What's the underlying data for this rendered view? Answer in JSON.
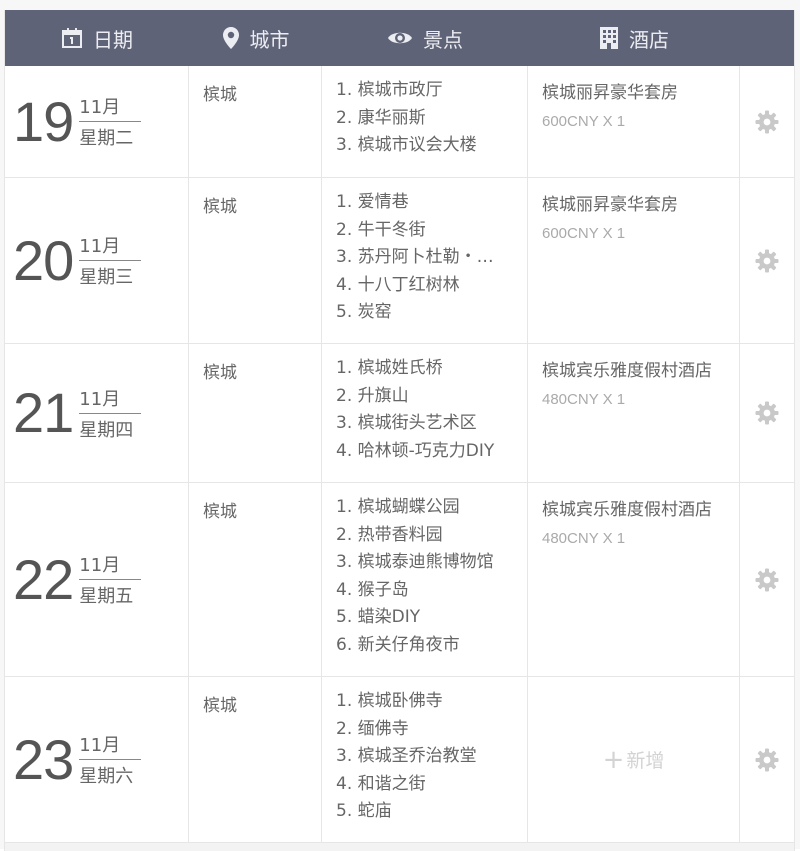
{
  "header": {
    "date_label": "日期",
    "city_label": "城市",
    "spot_label": "景点",
    "hotel_label": "酒店"
  },
  "colors": {
    "header_bg": "#5f6377",
    "header_text": "#ecedf2",
    "gear": "#c9c9c9"
  },
  "days": [
    {
      "day": "19",
      "month": "11月",
      "weekday": "星期二",
      "city": "槟城",
      "spots": [
        "1. 槟城市政厅",
        "2. 康华丽斯",
        "3. 槟城市议会大楼"
      ],
      "hotel": "槟城丽昇豪华套房",
      "price": "600CNY X 1"
    },
    {
      "day": "20",
      "month": "11月",
      "weekday": "星期三",
      "city": "槟城",
      "spots": [
        "1. 爱情巷",
        "2. 牛干冬街",
        "3. 苏丹阿卜杜勒・…",
        "4. 十八丁红树林",
        "5. 炭窑"
      ],
      "hotel": "槟城丽昇豪华套房",
      "price": "600CNY X 1"
    },
    {
      "day": "21",
      "month": "11月",
      "weekday": "星期四",
      "city": "槟城",
      "spots": [
        "1. 槟城姓氏桥",
        "2. 升旗山",
        "3. 槟城街头艺术区",
        "4. 哈林顿-巧克力DIY"
      ],
      "hotel": "槟城宾乐雅度假村酒店",
      "price": "480CNY X 1"
    },
    {
      "day": "22",
      "month": "11月",
      "weekday": "星期五",
      "city": "槟城",
      "spots": [
        "1. 槟城蝴蝶公园",
        "2. 热带香料园",
        "3. 槟城泰迪熊博物馆",
        "4. 猴子岛",
        "5. 蜡染DIY",
        "6. 新关仔角夜市"
      ],
      "hotel": "槟城宾乐雅度假村酒店",
      "price": "480CNY X 1"
    },
    {
      "day": "23",
      "month": "11月",
      "weekday": "星期六",
      "city": "槟城",
      "spots": [
        "1. 槟城卧佛寺",
        "2. 缅佛寺",
        "3. 槟城圣乔治教堂",
        "4. 和谐之街",
        "5. 蛇庙"
      ],
      "hotel": "",
      "price": "",
      "add_label": "新增"
    }
  ]
}
